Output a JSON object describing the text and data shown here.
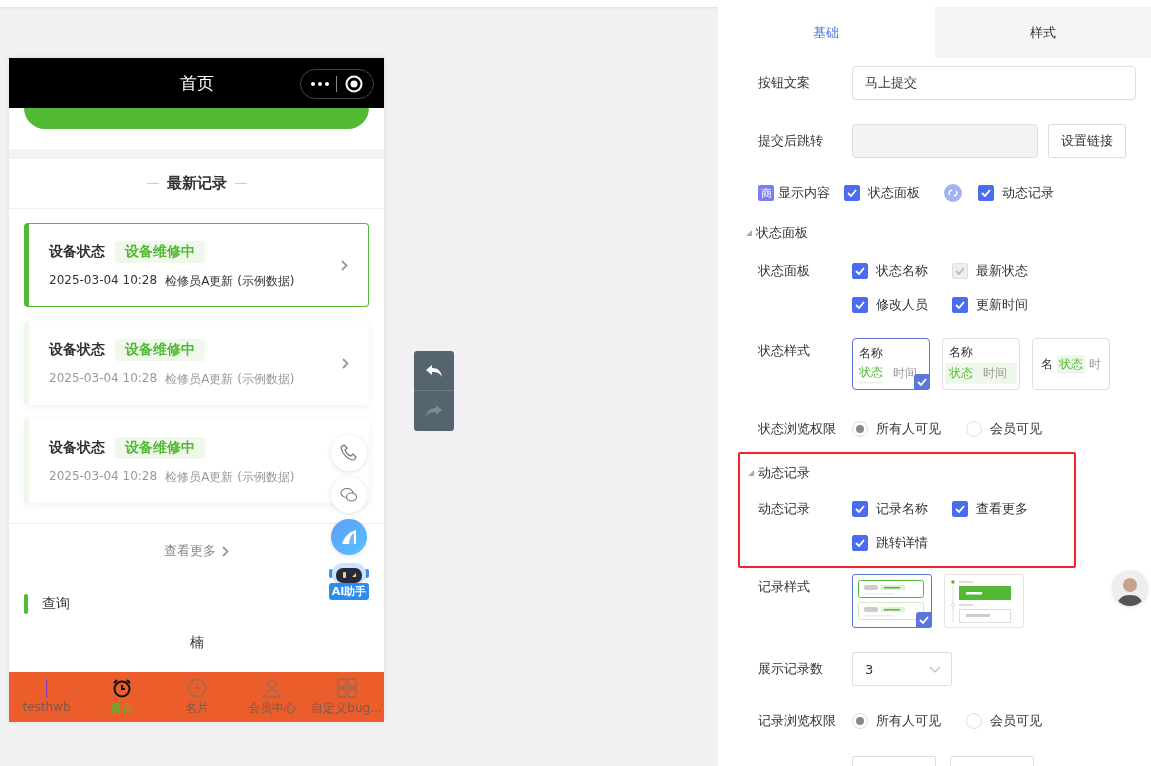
{
  "phone": {
    "title": "首页",
    "section_title": "最新记录",
    "records": [
      {
        "name": "设备状态",
        "status": "设备维修中",
        "time": "2025-03-04 10:28",
        "note": "检修员A更新 (示例数据)",
        "selected": true
      },
      {
        "name": "设备状态",
        "status": "设备维修中",
        "time": "2025-03-04 10:28",
        "note": "检修员A更新 (示例数据)",
        "selected": false
      },
      {
        "name": "设备状态",
        "status": "设备维修中",
        "time": "2025-03-04 10:28",
        "note": "检修员A更新 (示例数据)",
        "selected": false
      }
    ],
    "view_more": "查看更多",
    "query": {
      "title": "查询",
      "text": "楠"
    },
    "assistant_label": "AI助手",
    "tabbar": [
      {
        "label": "testhwb",
        "selected": false
      },
      {
        "label": "首页",
        "selected": true
      },
      {
        "label": "名片",
        "selected": false
      },
      {
        "label": "会员中心",
        "selected": false
      },
      {
        "label": "自定义bug...",
        "selected": false
      }
    ]
  },
  "settings": {
    "tabs": [
      {
        "label": "基础",
        "selected": true
      },
      {
        "label": "样式",
        "selected": false
      }
    ],
    "button_text": {
      "label": "按钮文案",
      "value": "马上提交"
    },
    "jump": {
      "label": "提交后跳转",
      "button": "设置链接"
    },
    "display": {
      "badge": "商",
      "label": "显示内容",
      "options": [
        {
          "label": "状态面板",
          "checked": true
        },
        {
          "label": "动态记录",
          "checked": true
        }
      ]
    },
    "status_section": {
      "title": "状态面板",
      "fields_label": "状态面板",
      "fields": [
        {
          "label": "状态名称",
          "checked": true,
          "disabled": false
        },
        {
          "label": "最新状态",
          "checked": true,
          "disabled": true
        },
        {
          "label": "修改人员",
          "checked": true,
          "disabled": false
        },
        {
          "label": "更新时间",
          "checked": true,
          "disabled": false
        }
      ],
      "style_label": "状态样式",
      "styles": [
        {
          "kind": "stacked",
          "name": "名称",
          "status": "状态",
          "time": "时间",
          "selected": true
        },
        {
          "kind": "banded",
          "name": "名称",
          "status": "状态",
          "time": "时间",
          "selected": false
        },
        {
          "kind": "inline",
          "name": "名",
          "status": "状态",
          "time": "时",
          "selected": false
        }
      ],
      "visibility": {
        "label": "状态浏览权限",
        "options": [
          {
            "label": "所有人可见",
            "selected": true
          },
          {
            "label": "会员可见",
            "selected": false
          }
        ]
      }
    },
    "record_section": {
      "title": "动态记录",
      "highlighted": true,
      "fields_label": "动态记录",
      "fields": [
        {
          "label": "记录名称",
          "checked": true,
          "disabled": false
        },
        {
          "label": "查看更多",
          "checked": true,
          "disabled": false
        },
        {
          "label": "跳转详情",
          "checked": true,
          "disabled": false
        }
      ],
      "style_label": "记录样式",
      "styles": [
        {
          "kind": "cards",
          "selected": true
        },
        {
          "kind": "timeline",
          "selected": false
        }
      ],
      "count": {
        "label": "展示记录数",
        "value": "3"
      },
      "visibility": {
        "label": "记录浏览权限",
        "options": [
          {
            "label": "所有人可见",
            "selected": true
          },
          {
            "label": "会员可见",
            "selected": false
          }
        ]
      }
    }
  }
}
